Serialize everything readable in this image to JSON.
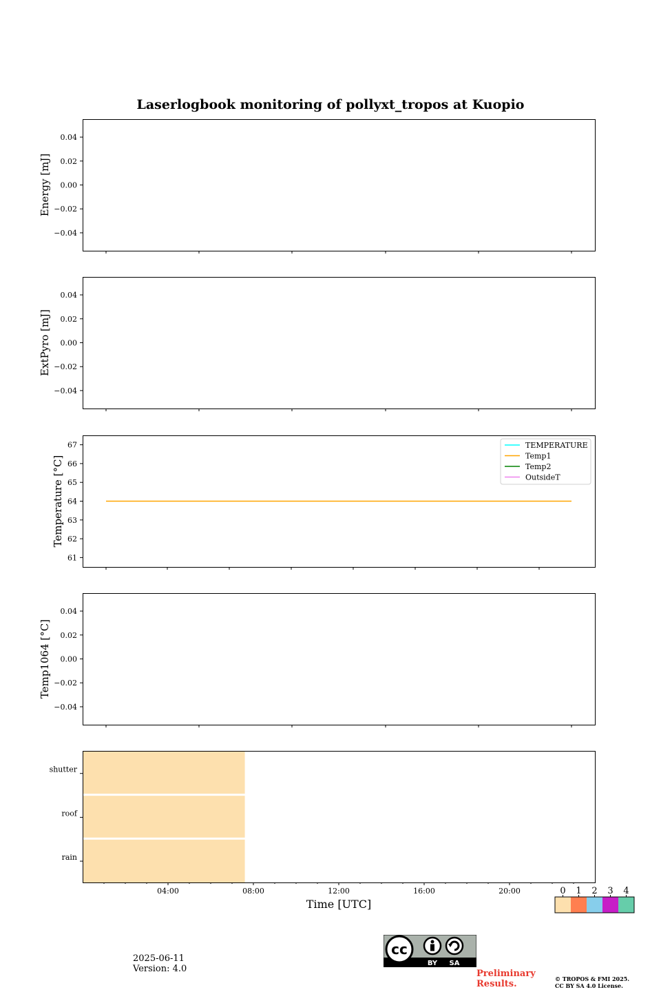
{
  "title": "Laserlogbook monitoring of pollyxt_tropos at Kuopio",
  "footer": {
    "date": "2025-06-11",
    "version": "Version: 4.0",
    "preliminary_line1": "Preliminary",
    "preliminary_line2": "Results.",
    "copyright_line1": "© TROPOS & FMI 2025.",
    "copyright_line2": "CC BY SA 4.0 License.",
    "license_by": "BY",
    "license_sa": "SA"
  },
  "chart_data": [
    {
      "type": "line",
      "ylabel": "Energy [mJ]",
      "ylim": [
        -0.055,
        0.055
      ],
      "yticks": [
        0.04,
        0.02,
        0.0,
        -0.02,
        -0.04
      ],
      "ytick_labels": [
        "0.04",
        "0.02",
        "0.00",
        "−0.02",
        "−0.04"
      ],
      "series": []
    },
    {
      "type": "line",
      "ylabel": "ExtPyro [mJ]",
      "ylim": [
        -0.055,
        0.055
      ],
      "yticks": [
        0.04,
        0.02,
        0.0,
        -0.02,
        -0.04
      ],
      "ytick_labels": [
        "0.04",
        "0.02",
        "0.00",
        "−0.02",
        "−0.04"
      ],
      "series": []
    },
    {
      "type": "line",
      "ylabel": "Temperature [°C]",
      "ylim": [
        60.5,
        67.5
      ],
      "yticks": [
        67,
        66,
        65,
        64,
        63,
        62,
        61
      ],
      "ytick_labels": [
        "67",
        "66",
        "65",
        "64",
        "63",
        "62",
        "61"
      ],
      "legend": "top-right",
      "series": [
        {
          "name": "TEMPERATURE",
          "color": "#00ffff",
          "x": [],
          "values": []
        },
        {
          "name": "Temp1",
          "color": "#ffa500",
          "x": [
            0,
            1
          ],
          "values": [
            64,
            64
          ]
        },
        {
          "name": "Temp2",
          "color": "#008000",
          "x": [],
          "values": []
        },
        {
          "name": "OutsideT",
          "color": "#ee82ee",
          "x": [],
          "values": []
        }
      ]
    },
    {
      "type": "line",
      "ylabel": "Temp1064 [°C]",
      "ylim": [
        -0.055,
        0.055
      ],
      "yticks": [
        0.04,
        0.02,
        0.0,
        -0.02,
        -0.04
      ],
      "ytick_labels": [
        "0.04",
        "0.02",
        "0.00",
        "−0.02",
        "−0.04"
      ],
      "series": []
    },
    {
      "type": "heatmap",
      "xlabel": "Time [UTC]",
      "xlim_hours": [
        0,
        24
      ],
      "xticks_hours": [
        4,
        8,
        12,
        16,
        20
      ],
      "xtick_labels": [
        "04:00",
        "08:00",
        "12:00",
        "16:00",
        "20:00"
      ],
      "rows": [
        "shutter",
        "roof",
        "rain"
      ],
      "cells": [
        {
          "row": "shutter",
          "start_hour": 0,
          "end_hour": 7.6,
          "status": 0
        },
        {
          "row": "roof",
          "start_hour": 0,
          "end_hour": 7.6,
          "status": 0
        },
        {
          "row": "rain",
          "start_hour": 0,
          "end_hour": 7.6,
          "status": 0
        }
      ],
      "colorbar": {
        "labels": [
          "0",
          "1",
          "2",
          "3",
          "4"
        ],
        "colors": [
          "#fde0ae",
          "#ff7f50",
          "#87ceeb",
          "#c71ec7",
          "#66cdaa"
        ]
      }
    }
  ]
}
